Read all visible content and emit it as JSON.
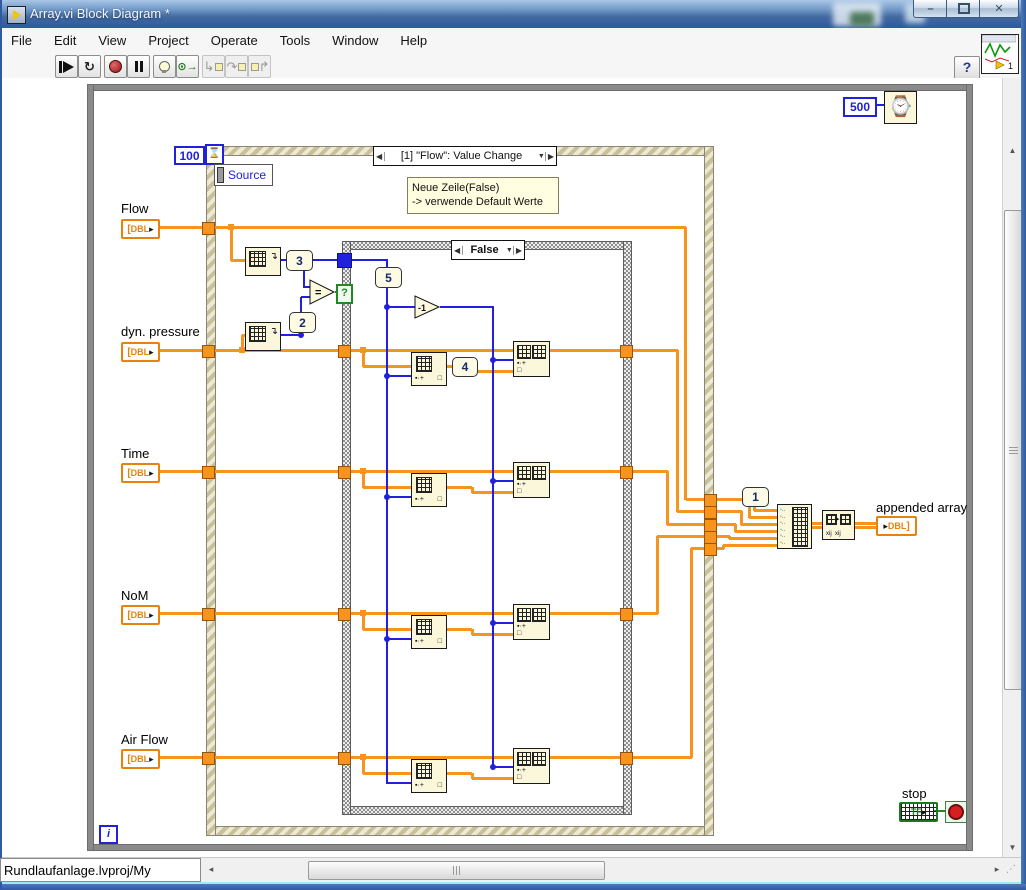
{
  "window": {
    "title": "Array.vi Block Diagram *",
    "controls": {
      "minimize": "–",
      "close": "✕"
    }
  },
  "menu": {
    "items": [
      "File",
      "Edit",
      "View",
      "Project",
      "Operate",
      "Tools",
      "Window",
      "Help"
    ]
  },
  "toolbar": {
    "help_label": "?",
    "vi_icon_badge": "1",
    "buttons": [
      "run",
      "run-continuously",
      "abort",
      "pause",
      "highlight-execution",
      "retain-wire-values",
      "step-into",
      "step-over",
      "step-out"
    ]
  },
  "status_bar": {
    "context": "Rundlaufanlage.lvproj/My Computer"
  },
  "diagram": {
    "while_loop": {
      "iteration_label": "i",
      "wait_ms": "500"
    },
    "event_structure": {
      "timeout": "100",
      "selector": "[1] \"Flow\": Value Change",
      "source_label": "Source",
      "comment_line1": "Neue Zeile(False)",
      "comment_line2": "-> verwende Default Werte"
    },
    "case_structure": {
      "selector": "False",
      "selector_tunnel": "?"
    },
    "constants": {
      "size_flow": "3",
      "size_dyn": "2",
      "rows": "5",
      "col_index": "4",
      "append_index": "1"
    },
    "functions": {
      "equal": "=",
      "decrement": "-1"
    },
    "inputs": [
      {
        "label": "Flow",
        "type": "DBL"
      },
      {
        "label": "dyn. pressure",
        "type": "DBL"
      },
      {
        "label": "Time",
        "type": "DBL"
      },
      {
        "label": "NoM",
        "type": "DBL"
      },
      {
        "label": "Air Flow",
        "type": "DBL"
      }
    ],
    "output": {
      "label": "appended array",
      "type": "DBL"
    },
    "stop": {
      "label": "stop",
      "type": "TF"
    }
  },
  "colors": {
    "dbl_orange": "#F7941D",
    "int_blue": "#2020DD",
    "bool_green": "#1F8A1F",
    "structure_gray": "#8A8A8A",
    "comment_bg": "#FFFEE0",
    "titlebar_blue": "#2D5AA0"
  }
}
